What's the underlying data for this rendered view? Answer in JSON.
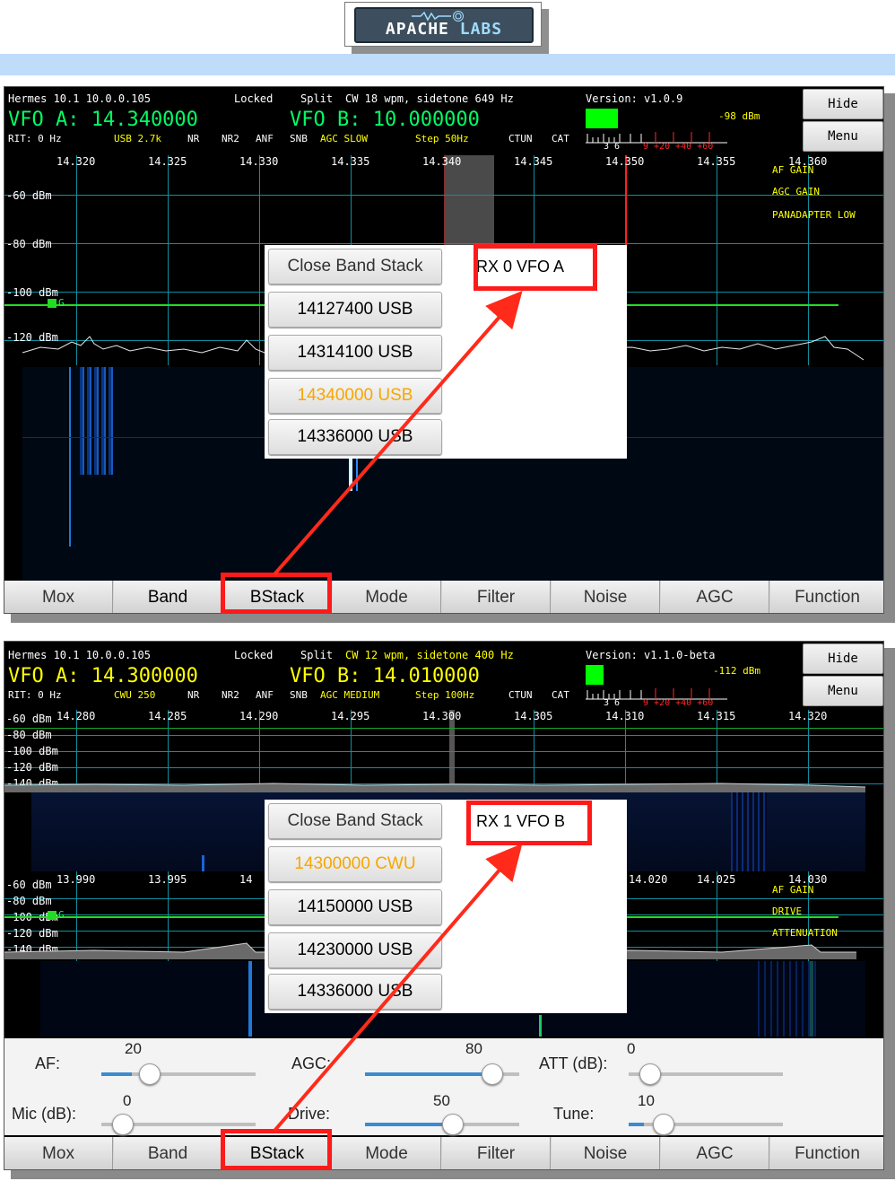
{
  "logo": {
    "brand": "APACHE",
    "brand2": "LABS"
  },
  "panel1": {
    "header": {
      "radio": "Hermes 10.1 10.0.0.105",
      "locked": "Locked",
      "split": "Split",
      "cw_info": "CW 18 wpm, sidetone 649 Hz",
      "version": "Version: v1.0.9",
      "vfo_a": "VFO A: 14.340000",
      "vfo_b": "VFO B: 10.000000",
      "rit": "RIT: 0 Hz",
      "mode_filter": "USB 2.7k",
      "nr": "NR",
      "nr2": "NR2",
      "anf": "ANF",
      "snb": "SNB",
      "agc": "AGC SLOW",
      "step": "Step 50Hz",
      "ctun": "CTUN",
      "cat": "CAT",
      "dbm": "-98 dBm",
      "s_scale_white": "3  6",
      "s_scale_red": "9 +20 +40 +60"
    },
    "side": {
      "hide": "Hide",
      "menu": "Menu"
    },
    "freq_labels": [
      "14.320",
      "14.325",
      "14.330",
      "14.335",
      "14.340",
      "14.345",
      "14.350",
      "14.355",
      "14.360"
    ],
    "db_labels": [
      "-60 dBm",
      "-80 dBm",
      "-100 dBm",
      "-120 dBm"
    ],
    "overlay_labels": [
      "AF GAIN",
      "AGC GAIN",
      "PANADAPTER LOW"
    ],
    "g_marker": "G",
    "dialog": {
      "title": "RX 0 VFO A",
      "close": "Close Band Stack",
      "entries": [
        "14127400 USB",
        "14314100 USB",
        "14340000 USB",
        "14336000 USB"
      ]
    },
    "buttons": [
      "Mox",
      "Band",
      "BStack",
      "Mode",
      "Filter",
      "Noise",
      "AGC",
      "Function"
    ]
  },
  "panel2": {
    "header": {
      "radio": "Hermes 10.1 10.0.0.105",
      "locked": "Locked",
      "split": "Split",
      "cw_info": "CW 12 wpm, sidetone 400 Hz",
      "version": "Version: v1.1.0-beta",
      "vfo_a": "VFO A: 14.300000",
      "vfo_b": "VFO B: 14.010000",
      "rit": "RIT: 0 Hz",
      "mode_filter": "CWU 250",
      "nr": "NR",
      "nr2": "NR2",
      "anf": "ANF",
      "snb": "SNB",
      "agc": "AGC MEDIUM",
      "step": "Step 100Hz",
      "ctun": "CTUN",
      "cat": "CAT",
      "dbm": "-112 dBm",
      "s_scale_white": "3  6",
      "s_scale_red": "9 +20 +40 +60"
    },
    "side": {
      "hide": "Hide",
      "menu": "Menu"
    },
    "freq_labels_a": [
      "14.280",
      "14.285",
      "14.290",
      "14.295",
      "14.300",
      "14.305",
      "14.310",
      "14.315",
      "14.320"
    ],
    "db_labels_a": [
      "-60 dBm",
      "-80 dBm",
      "-100 dBm",
      "-120 dBm",
      "-140 dBm"
    ],
    "freq_labels_b": [
      "13.990",
      "13.995",
      "14",
      "14.020",
      "14.025",
      "14.030"
    ],
    "db_labels_b": [
      "-60 dBm",
      "-80 dBm",
      "-100 dBm",
      "-120 dBm",
      "-140 dBm"
    ],
    "overlay_labels": [
      "AF GAIN",
      "DRIVE",
      "ATTENUATION"
    ],
    "g_marker": "G",
    "dialog": {
      "title": "RX 1 VFO B",
      "close": "Close Band Stack",
      "entries": [
        "14300000 CWU",
        "14150000 USB",
        "14230000 USB",
        "14336000 USB"
      ]
    },
    "sliders": {
      "af": {
        "label": "AF:",
        "value": "20",
        "level": 0.2
      },
      "agc": {
        "label": "AGC:",
        "value": "80",
        "level": 0.8
      },
      "att": {
        "label": "ATT (dB):",
        "value": "0",
        "level": 0.0
      },
      "mic": {
        "label": "Mic (dB):",
        "value": "0",
        "level": 0.0
      },
      "drive": {
        "label": "Drive:",
        "value": "50",
        "level": 0.5
      },
      "tune": {
        "label": "Tune:",
        "value": "10",
        "level": 0.1
      }
    },
    "buttons": [
      "Mox",
      "Band",
      "BStack",
      "Mode",
      "Filter",
      "Noise",
      "AGC",
      "Function"
    ]
  },
  "colors": {
    "vfo": "#00ff66",
    "status": "#ffff00",
    "grid": "#0e8fa0",
    "highlight": "#ff1a1a",
    "active_entry": "#f7a600"
  }
}
